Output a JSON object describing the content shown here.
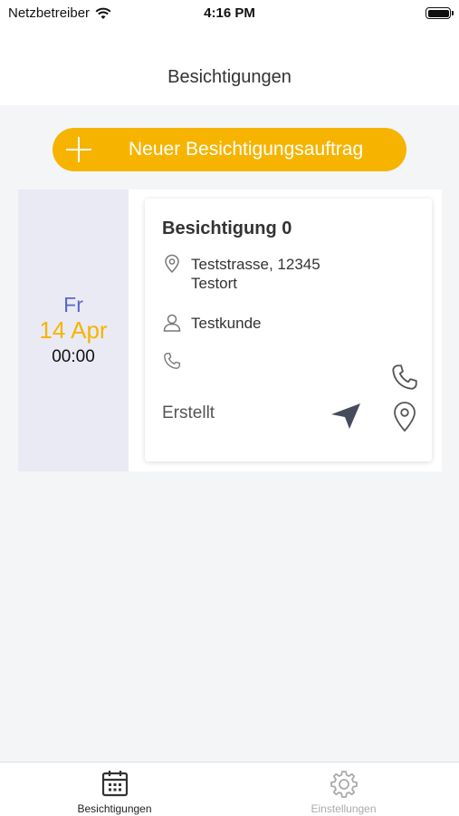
{
  "status_bar": {
    "carrier": "Netzbetreiber",
    "time": "4:16 PM"
  },
  "nav": {
    "title": "Besichtigungen"
  },
  "new_button": {
    "label": "Neuer Besichtigungsauftrag"
  },
  "appointments": [
    {
      "weekday": "Fr",
      "date": "14 Apr",
      "time": "00:00",
      "title": "Besichtigung  0",
      "address_line1": "Teststrasse, 12345",
      "address_line2": "Testort",
      "customer": "Testkunde",
      "phone": "",
      "status": "Erstellt"
    }
  ],
  "tabbar": {
    "tabs": [
      {
        "label": "Besichtigungen",
        "icon": "calendar-icon",
        "active": true
      },
      {
        "label": "Einstellungen",
        "icon": "gear-icon",
        "active": false
      }
    ]
  },
  "colors": {
    "accent": "#f6b400",
    "weekday": "#5a68c8",
    "date_bg": "#e9eaf3",
    "background": "#f4f5f7"
  }
}
